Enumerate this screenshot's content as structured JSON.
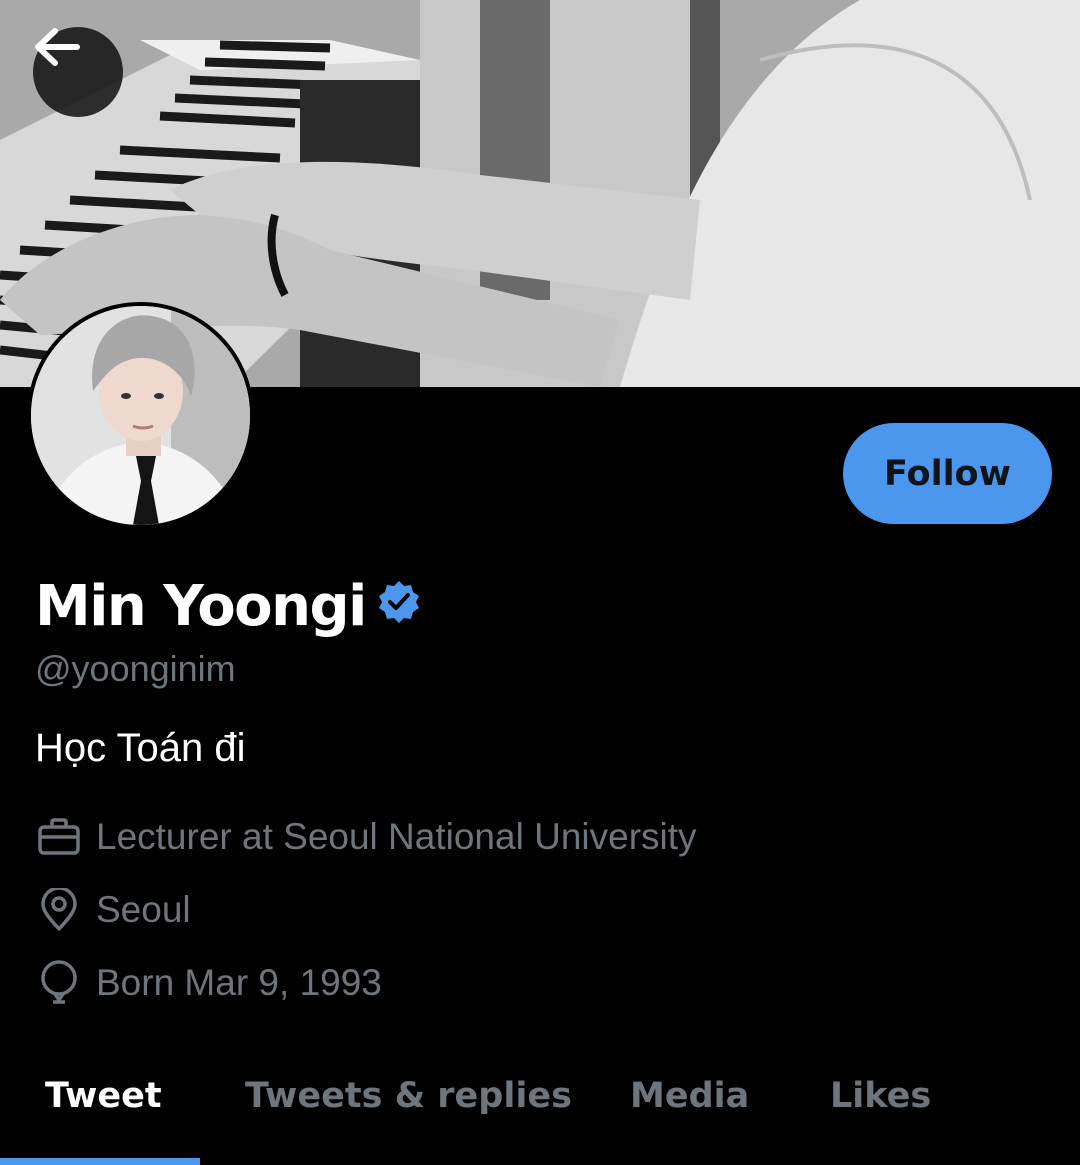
{
  "header": {
    "back_icon": "arrow-left-icon",
    "banner_image": "black-and-white photo of hands playing a piano keyboard",
    "avatar_image": "portrait of a person with light gray hair in white shirt and black tie"
  },
  "profile": {
    "display_name": "Min Yoongi",
    "verified_icon": "verified-badge-icon",
    "handle": "@yoonginim",
    "bio": "Học Toán đi",
    "work": "Lecturer at Seoul National University",
    "location": "Seoul",
    "birthday": "Born Mar 9, 1993"
  },
  "actions": {
    "follow_label": "Follow"
  },
  "tabs": [
    {
      "label": "Tweet",
      "active": true
    },
    {
      "label": "Tweets & replies",
      "active": false
    },
    {
      "label": "Media",
      "active": false
    },
    {
      "label": "Likes",
      "active": false
    }
  ],
  "colors": {
    "background": "#000000",
    "accent": "#4c97ee",
    "secondary_text": "#6e767d",
    "primary_text": "#ffffff"
  }
}
